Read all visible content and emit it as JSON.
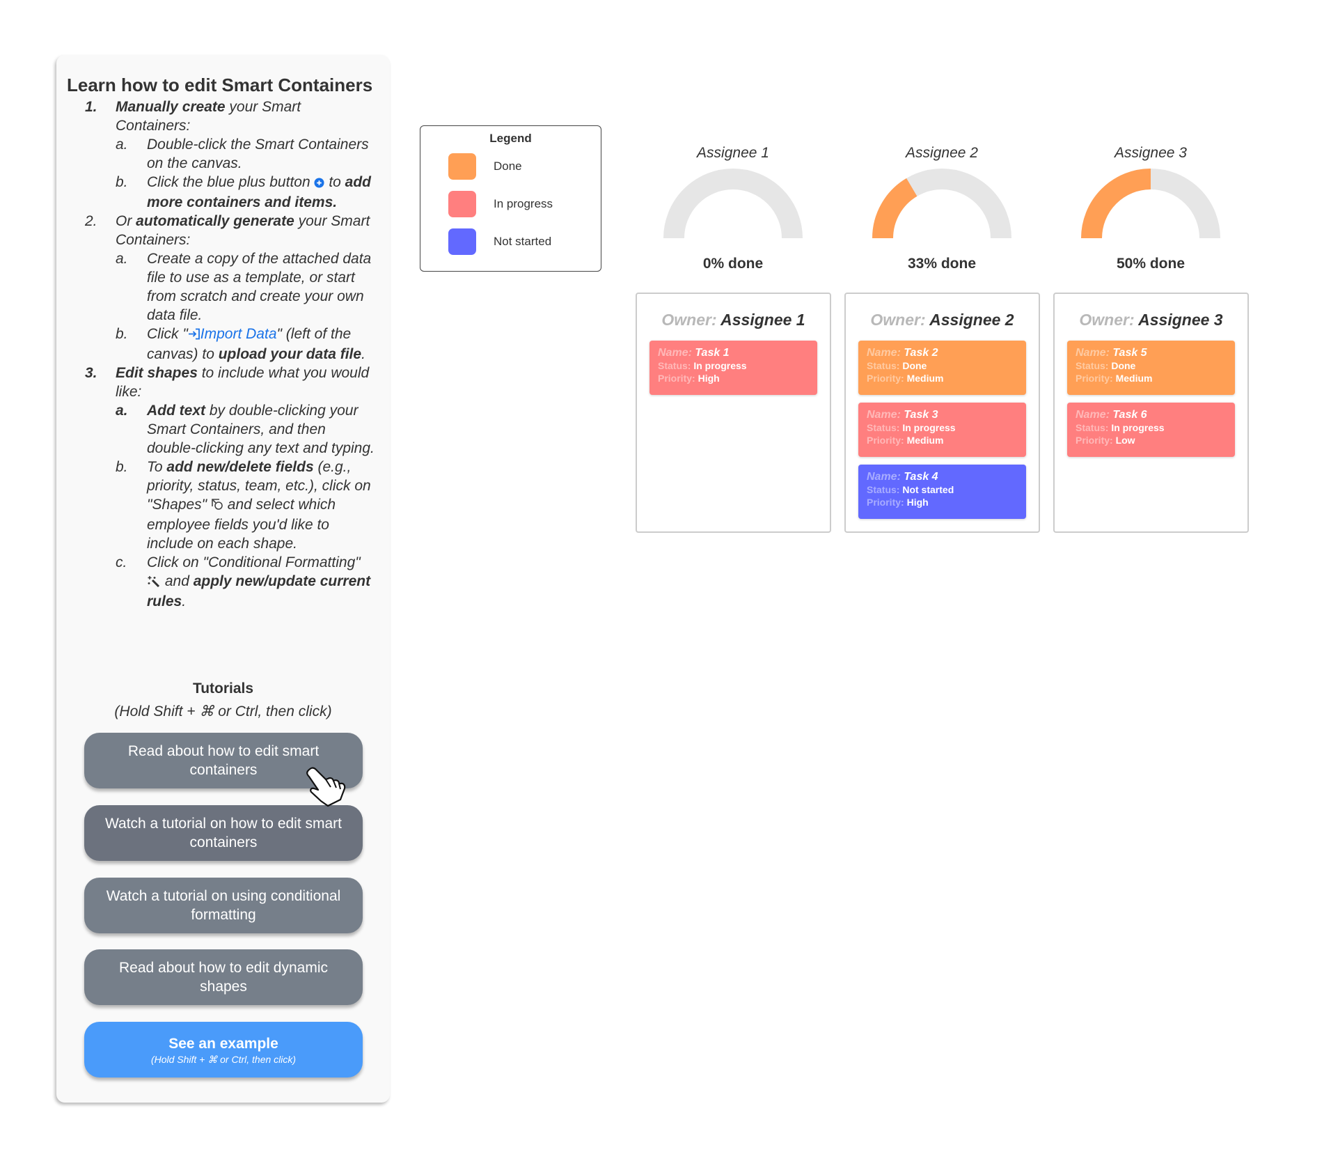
{
  "panel": {
    "title": "Learn how to edit Smart Containers",
    "steps": [
      {
        "num": "1.",
        "bold": "Manually create",
        "text": " your Smart Containers:",
        "subs": [
          {
            "letter": "a.",
            "text": "Double-click the Smart Containers on the canvas."
          },
          {
            "letter": "b.",
            "pre": "Click the blue plus button ",
            "icon": "plus-circle-icon",
            "post": " to ",
            "bold": "add more containers and items."
          }
        ]
      },
      {
        "num": "2.",
        "pre": "Or ",
        "bold": "automatically generate",
        "text": " your Smart Containers:",
        "subs": [
          {
            "letter": "a.",
            "text": "Create a copy of the attached data file to use as a template, or start from scratch and create your own data file."
          },
          {
            "letter": "b.",
            "pre": "Click \"",
            "icon": "import-icon",
            "link": "Import Data",
            "post": "\" (left of the canvas) to ",
            "bold": "upload your data file",
            "end": "."
          }
        ]
      },
      {
        "num": "3.",
        "bold": "Edit shapes",
        "text": " to include what you would like:",
        "subs": [
          {
            "letter": "a.",
            "bold": "Add text",
            "text": " by double-clicking your Smart Containers, and then double-clicking any text and typing."
          },
          {
            "letter": "b.",
            "pre": "To ",
            "bold": "add new/delete fields",
            "text": " (e.g., priority, status, team, etc.), click on \"Shapes\" ",
            "post": " and select which employee fields you'd like to include on each shape."
          },
          {
            "letter": "c.",
            "pre": "Click on \"Conditional Formatting\" ",
            "post": " and ",
            "bold": "apply new/update current rules",
            "end": "."
          }
        ]
      }
    ],
    "tutorials_title": "Tutorials",
    "tutorials_hint": "(Hold Shift + ⌘ or Ctrl, then click)",
    "buttons": [
      "Read about how to edit smart containers",
      "Watch a tutorial on how to edit smart containers",
      "Watch a tutorial on using conditional formatting",
      "Read about how to edit dynamic shapes"
    ],
    "example_button": {
      "label": "See an example",
      "hint": "(Hold Shift + ⌘ or Ctrl, then click)"
    }
  },
  "legend": {
    "title": "Legend",
    "items": [
      {
        "label": "Done",
        "color": "#ff9f55"
      },
      {
        "label": "In progress",
        "color": "#ff7f7f"
      },
      {
        "label": "Not started",
        "color": "#6269ff"
      }
    ]
  },
  "colors": {
    "done": "#ff9f55",
    "in_progress": "#ff7f7f",
    "not_started": "#6269ff",
    "gauge_track": "#e6e6e6"
  },
  "field_labels": {
    "owner": "Owner:",
    "name": "Name:",
    "status": "Status:",
    "priority": "Priority:"
  },
  "assignees": [
    {
      "name": "Assignee 1",
      "progress_pct": 0,
      "progress_label": "0% done",
      "tasks": [
        {
          "name": "Task 1",
          "status": "In progress",
          "priority": "High"
        }
      ]
    },
    {
      "name": "Assignee 2",
      "progress_pct": 33,
      "progress_label": "33% done",
      "tasks": [
        {
          "name": "Task 2",
          "status": "Done",
          "priority": "Medium"
        },
        {
          "name": "Task 3",
          "status": "In progress",
          "priority": "Medium"
        },
        {
          "name": "Task 4",
          "status": "Not started",
          "priority": "High"
        }
      ]
    },
    {
      "name": "Assignee 3",
      "progress_pct": 50,
      "progress_label": "50% done",
      "tasks": [
        {
          "name": "Task 5",
          "status": "Done",
          "priority": "Medium"
        },
        {
          "name": "Task 6",
          "status": "In progress",
          "priority": "Low"
        }
      ]
    }
  ]
}
